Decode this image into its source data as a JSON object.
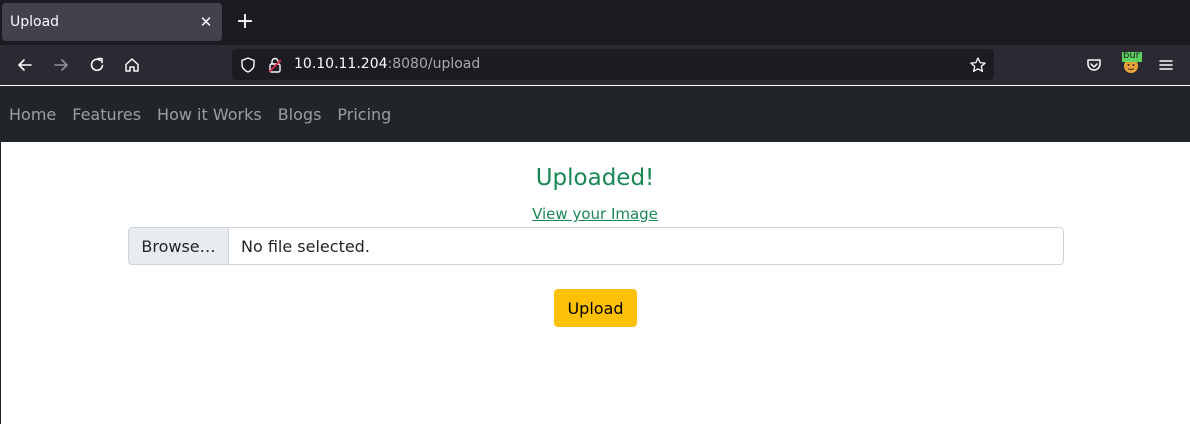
{
  "browser": {
    "tab_title": "Upload",
    "tab_close": "✕",
    "new_tab": "+",
    "url_host": "10.10.11.204",
    "url_rest": ":8080/upload",
    "extension_label": "bur"
  },
  "site_nav": {
    "items": [
      "Home",
      "Features",
      "How it Works",
      "Blogs",
      "Pricing"
    ]
  },
  "content": {
    "heading": "Uploaded!",
    "view_link": "View your Image",
    "browse_label": "Browse…",
    "file_status": "No file selected.",
    "upload_label": "Upload"
  },
  "colors": {
    "success": "#198754",
    "warning": "#ffc107",
    "navbar_dark": "#212529"
  }
}
